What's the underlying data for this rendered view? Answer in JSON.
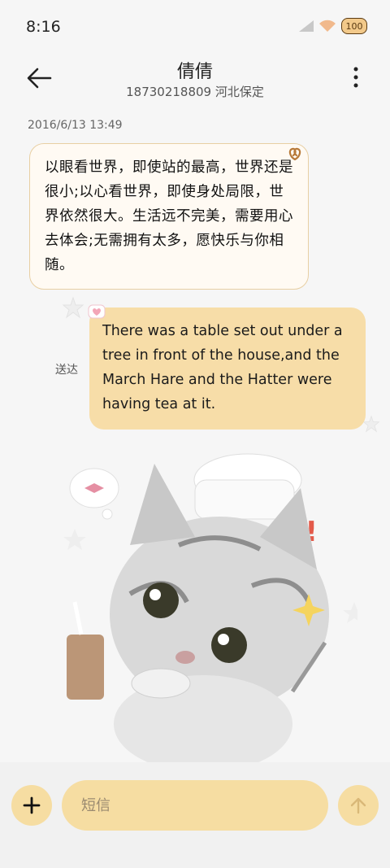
{
  "status_bar": {
    "time": "8:16",
    "battery": "100"
  },
  "header": {
    "contact_name": "倩倩",
    "contact_subtitle": "18730218809 河北保定"
  },
  "conversation": {
    "date": "2016/6/13 13:49",
    "incoming_message": "以眼看世界，即使站的最高，世界还是很小;以心看世界，即使身处局限，世界依然很大。生活远不完美，需要用心去体会;无需拥有太多，愿快乐与你相随。",
    "outgoing_message": "There was a table set out under a tree in front of the house,and the March Hare and the Hatter were having tea at it.",
    "delivery_status": "送达"
  },
  "composer": {
    "placeholder": "短信"
  },
  "colors": {
    "accent": "#f6dda2",
    "bubble_out": "#f7dda8",
    "bubble_in_border": "#e8cfa3"
  }
}
